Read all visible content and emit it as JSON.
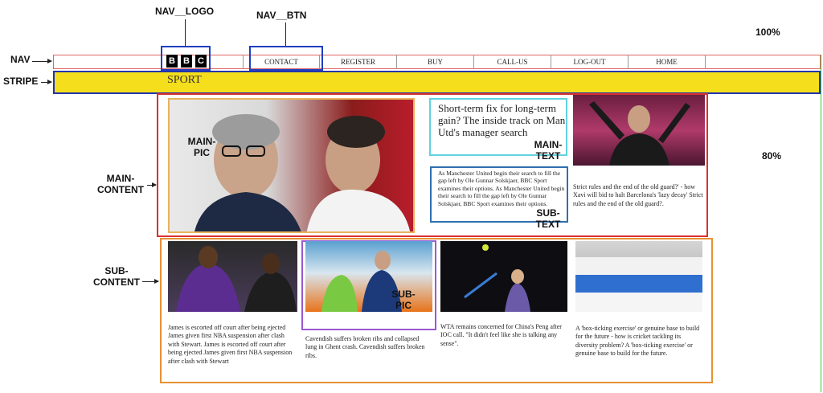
{
  "annotations": {
    "nav_logo": "NAV__LOGO",
    "nav_btn": "NAV__BTN",
    "nav": "NAV",
    "stripe": "STRIPE",
    "main_content": "MAIN-\nCONTENT",
    "main_pic": "MAIN-\nPIC",
    "main_text": "MAIN-\nTEXT",
    "sub_text": "SUB-\nTEXT",
    "sub_content": "SUB-\nCONTENT",
    "sub_pic": "SUB-\nPIC",
    "pct_100": "100%",
    "pct_80": "80%"
  },
  "logo": {
    "letters": [
      "B",
      "B",
      "C"
    ]
  },
  "nav": {
    "buttons": [
      "CONTACT",
      "REGISTER",
      "BUY",
      "CALL-US",
      "LOG-OUT",
      "HOME"
    ]
  },
  "stripe": {
    "label": "SPORT"
  },
  "main": {
    "headline": "Short-term fix for long-term gain? The inside track on Man Utd's manager search",
    "summary": "As Manchester United begin their search to fill the gap left by Ole Gunnar Solskjaer, BBC Sport examines their options. As Manchester United begin their search to fill the gap left by Ole Gunnar Solskjaer, BBC Sport examines their options.",
    "side_text": "Strict rules and the end of the old guard?' - how Xavi will bid to halt Barcelona's 'lazy decay' Strict rules and the end of the old guard?."
  },
  "sub": {
    "stories": [
      "James is escorted off court after being ejected James given first NBA suspension after clash with Stewart. James is escorted off court after being ejected James given first NBA suspension after clash with Stewart",
      "Cavendish suffers broken ribs and collapsed lung in Ghent crash. Cavendish suffers broken ribs.",
      "WTA remains concerned for China's Peng after IOC call. \"It didn't feel like she is talking any sense\".",
      "A 'box-ticking exercise' or genuine base to build for the future - how is cricket tackling its diversity problem? A 'box-ticking exercise' or genuine base to build for the future."
    ]
  }
}
